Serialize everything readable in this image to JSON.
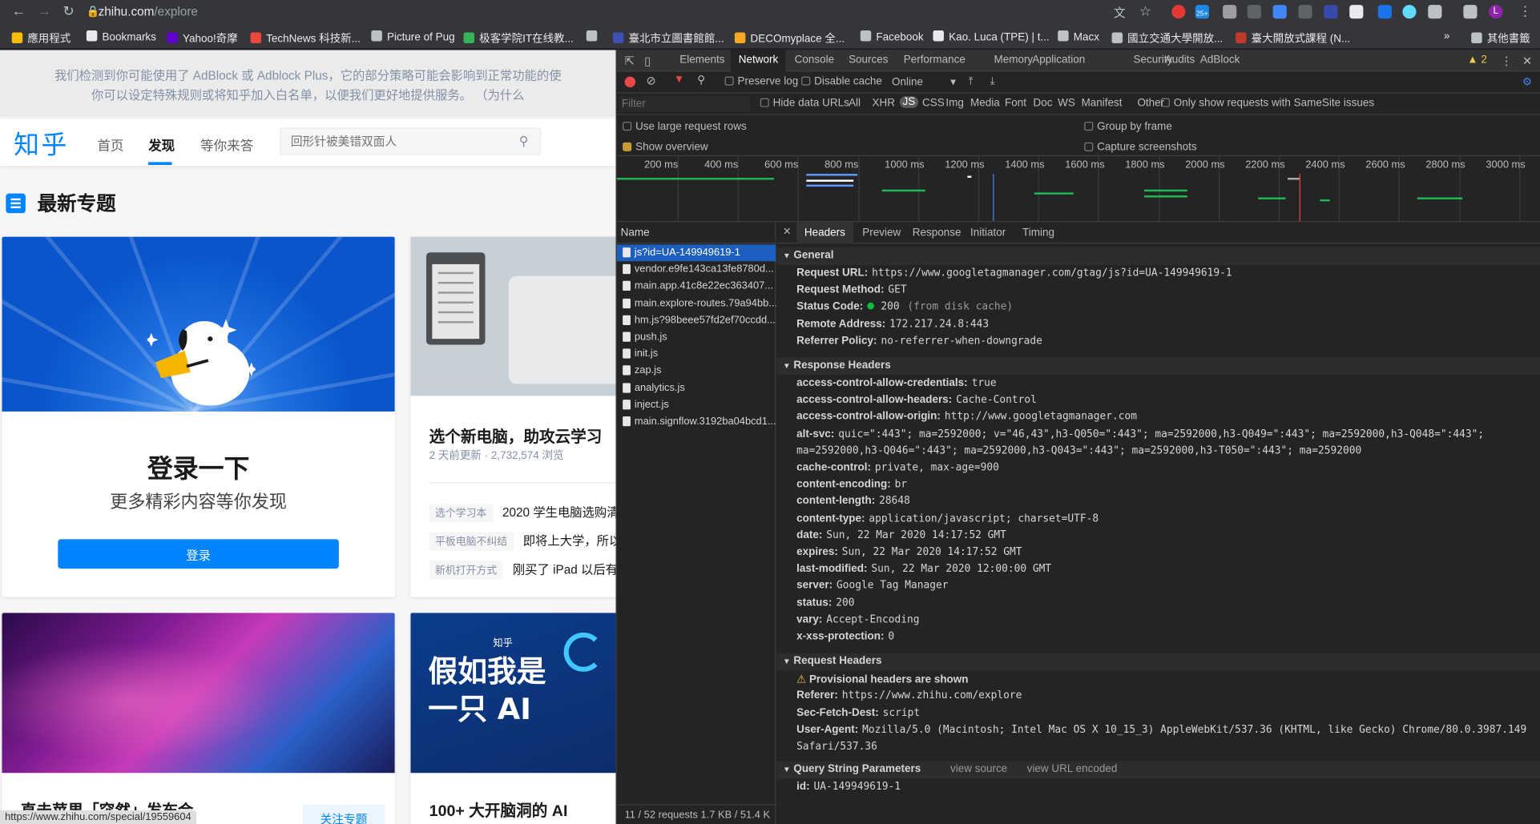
{
  "browser": {
    "url_host": "zhihu.com",
    "url_path": "/explore",
    "bookmarks": [
      {
        "label": "應用程式",
        "color": "#fbbc04"
      },
      {
        "label": "Bookmarks",
        "color": "#e8eaed"
      },
      {
        "label": "Yahoo!奇摩",
        "color": "#6001d2"
      },
      {
        "label": "TechNews 科技新...",
        "color": "#e8493a"
      },
      {
        "label": "Picture of Pug",
        "color": "#bdc1c6"
      },
      {
        "label": "极客学院IT在线教...",
        "color": "#35b558"
      },
      {
        "label": "",
        "color": "#bdc1c6"
      },
      {
        "label": "臺北市立圖書館館...",
        "color": "#3f51b5"
      },
      {
        "label": "DECOmyplace 全...",
        "color": "#f9a825"
      },
      {
        "label": "Facebook",
        "color": "#bdc1c6"
      },
      {
        "label": "Kao. Luca (TPE) | t...",
        "color": "#e8eaed"
      },
      {
        "label": "Macx",
        "color": "#bdc1c6"
      },
      {
        "label": "國立交通大學開放...",
        "color": "#bdc1c6"
      },
      {
        "label": "臺大開放式課程 (N...",
        "color": "#c0392b"
      }
    ],
    "more_label": "»",
    "other_bookmarks": "其他書籤",
    "status_url": "https://www.zhihu.com/special/19559604",
    "ext_badge": "25+",
    "profile_initial": "L"
  },
  "page": {
    "adblock_line1": "我们检测到你可能使用了 AdBlock 或 Adblock Plus，它的部分策略可能会影响到正常功能的使",
    "adblock_line2": "你可以设定特殊规则或将知乎加入白名单，以便我们更好地提供服务。 （为什么",
    "logo": "知乎",
    "nav": [
      "首页",
      "发现",
      "等你来答"
    ],
    "search_placeholder": "回形针被美错双面人",
    "section_title": "最新专题",
    "login": {
      "title": "登录一下",
      "subtitle": "更多精彩内容等你发现",
      "button": "登录"
    },
    "topic": {
      "title": "选个新电脑，助攻云学习",
      "meta": "2 天前更新 · 2,732,574 浏览",
      "rows": [
        {
          "tag": "选个学习本",
          "text": "2020 学生电脑选购清"
        },
        {
          "tag": "平板电脑不纠结",
          "text": "即将上大学，所以"
        },
        {
          "tag": "新机打开方式",
          "text": "刚买了 iPad 以后有什"
        }
      ]
    },
    "apple_title": "直击苹果「突然」发布会",
    "follow_button": "关注专题",
    "ai": {
      "tag": "知乎",
      "big_line1": "假如我是",
      "big_line2": "一只 AI",
      "title": "100+ 大开脑洞的 AI"
    }
  },
  "devtools": {
    "tabs": [
      "Elements",
      "Network",
      "Console",
      "Sources",
      "Performance",
      "Memory",
      "Application",
      "Security",
      "Audits",
      "AdBlock"
    ],
    "active_tab": "Network",
    "warning_count": "2",
    "toolbar": {
      "preserve_log": "Preserve log",
      "disable_cache": "Disable cache",
      "throttle": "Online"
    },
    "filter_placeholder": "Filter",
    "hide_data_urls": "Hide data URLs",
    "types": [
      "All",
      "XHR",
      "JS",
      "CSS",
      "Img",
      "Media",
      "Font",
      "Doc",
      "WS",
      "Manifest",
      "Other"
    ],
    "selected_type": "JS",
    "samesite_label": "Only show requests with SameSite issues",
    "options": {
      "large_rows": "Use large request rows",
      "show_overview": "Show overview",
      "group_by_frame": "Group by frame",
      "capture_screenshots": "Capture screenshots"
    },
    "timeline_ticks": [
      "200 ms",
      "400 ms",
      "600 ms",
      "800 ms",
      "1000 ms",
      "1200 ms",
      "1400 ms",
      "1600 ms",
      "1800 ms",
      "2000 ms",
      "2200 ms",
      "2400 ms",
      "2600 ms",
      "2800 ms",
      "3000 ms"
    ],
    "name_header": "Name",
    "requests": [
      "js?id=UA-149949619-1",
      "vendor.e9fe143ca13fe8780d...",
      "main.app.41c8e22ec363407...",
      "main.explore-routes.79a94bb...",
      "hm.js?98beee57fd2ef70ccdd...",
      "push.js",
      "init.js",
      "zap.js",
      "analytics.js",
      "inject.js",
      "main.signflow.3192ba04bcd1..."
    ],
    "status_bar": "11 / 52 requests   1.7 KB / 51.4 K",
    "detail_tabs": [
      "Headers",
      "Preview",
      "Response",
      "Initiator",
      "Timing"
    ],
    "active_detail_tab": "Headers",
    "general_title": "General",
    "general": [
      {
        "k": "Request URL:",
        "v": "https://www.googletagmanager.com/gtag/js?id=UA-149949619-1"
      },
      {
        "k": "Request Method:",
        "v": "GET"
      },
      {
        "k": "Status Code:",
        "v": "200",
        "extra": "(from disk cache)"
      },
      {
        "k": "Remote Address:",
        "v": "172.217.24.8:443"
      },
      {
        "k": "Referrer Policy:",
        "v": "no-referrer-when-downgrade"
      }
    ],
    "response_title": "Response Headers",
    "response_headers": [
      {
        "k": "access-control-allow-credentials:",
        "v": "true"
      },
      {
        "k": "access-control-allow-headers:",
        "v": "Cache-Control"
      },
      {
        "k": "access-control-allow-origin:",
        "v": "http://www.googletagmanager.com"
      },
      {
        "k": "alt-svc:",
        "v": "quic=\":443\"; ma=2592000; v=\"46,43\",h3-Q050=\":443\"; ma=2592000,h3-Q049=\":443\"; ma=2592000,h3-Q048=\":443\"; ma=2592000,h3-Q046=\":443\"; ma=2592000,h3-Q043=\":443\"; ma=2592000,h3-T050=\":443\"; ma=2592000"
      },
      {
        "k": "cache-control:",
        "v": "private, max-age=900"
      },
      {
        "k": "content-encoding:",
        "v": "br"
      },
      {
        "k": "content-length:",
        "v": "28648"
      },
      {
        "k": "content-type:",
        "v": "application/javascript; charset=UTF-8"
      },
      {
        "k": "date:",
        "v": "Sun, 22 Mar 2020 14:17:52 GMT"
      },
      {
        "k": "expires:",
        "v": "Sun, 22 Mar 2020 14:17:52 GMT"
      },
      {
        "k": "last-modified:",
        "v": "Sun, 22 Mar 2020 12:00:00 GMT"
      },
      {
        "k": "server:",
        "v": "Google Tag Manager"
      },
      {
        "k": "status:",
        "v": "200"
      },
      {
        "k": "vary:",
        "v": "Accept-Encoding"
      },
      {
        "k": "x-xss-protection:",
        "v": "0"
      }
    ],
    "request_title": "Request Headers",
    "provisional": "Provisional headers are shown",
    "request_headers": [
      {
        "k": "Referer:",
        "v": "https://www.zhihu.com/explore"
      },
      {
        "k": "Sec-Fetch-Dest:",
        "v": "script"
      },
      {
        "k": "User-Agent:",
        "v": "Mozilla/5.0 (Macintosh; Intel Mac OS X 10_15_3) AppleWebKit/537.36 (KHTML, like Gecko) Chrome/80.0.3987.149 Safari/537.36"
      }
    ],
    "query_title": "Query String Parameters",
    "view_source": "view source",
    "view_url_encoded": "view URL encoded",
    "query_params": [
      {
        "k": "id:",
        "v": "UA-149949619-1"
      }
    ]
  }
}
